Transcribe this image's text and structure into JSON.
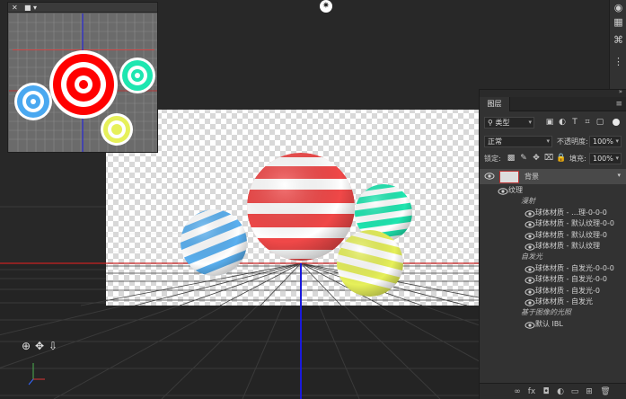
{
  "secondary_view": {
    "close_glyph": "✕",
    "camera_glyph": "■",
    "menu_glyph": "▾"
  },
  "light_glyph": "✷",
  "right_tools": [
    "◉",
    "▦",
    "⌘",
    "⋮"
  ],
  "layers_panel": {
    "collapse_glyph": "»",
    "tab_label": "图层",
    "menu_glyph": "≡",
    "filter": {
      "value": "类型",
      "icons": [
        "image-filter-icon",
        "adjust-filter-icon",
        "text-filter-icon",
        "shape-filter-icon",
        "smart-filter-icon"
      ]
    },
    "blend_mode": "正常",
    "opacity_label": "不透明度:",
    "opacity_value": "100%",
    "lock_label": "锁定:",
    "fill_label": "填充:",
    "fill_value": "100%",
    "layers": [
      {
        "label": "背景",
        "indent": 0,
        "type": "layer",
        "has_eye": true,
        "selected": true
      },
      {
        "label": "纹理",
        "indent": 1,
        "type": "group",
        "has_eye": true
      },
      {
        "label": "漫射",
        "indent": 2,
        "type": "section",
        "has_eye": false
      },
      {
        "label": "球体材质 - …理-0-0-0",
        "indent": 3,
        "type": "item",
        "has_eye": true
      },
      {
        "label": "球体材质 - 默认纹理-0-0",
        "indent": 3,
        "type": "item",
        "has_eye": true
      },
      {
        "label": "球体材质 - 默认纹理-0",
        "indent": 3,
        "type": "item",
        "has_eye": true
      },
      {
        "label": "球体材质 - 默认纹理",
        "indent": 3,
        "type": "item",
        "has_eye": true
      },
      {
        "label": "自发光",
        "indent": 2,
        "type": "section",
        "has_eye": false
      },
      {
        "label": "球体材质 - 自发光-0-0-0",
        "indent": 3,
        "type": "item",
        "has_eye": true
      },
      {
        "label": "球体材质 - 自发光-0-0",
        "indent": 3,
        "type": "item",
        "has_eye": true
      },
      {
        "label": "球体材质 - 自发光-0",
        "indent": 3,
        "type": "item",
        "has_eye": true
      },
      {
        "label": "球体材质 - 自发光",
        "indent": 3,
        "type": "item",
        "has_eye": true
      },
      {
        "label": "基于图像的光照",
        "indent": 2,
        "type": "section",
        "has_eye": false
      },
      {
        "label": "默认 IBL",
        "indent": 3,
        "type": "item",
        "has_eye": true
      }
    ],
    "bottom_icons": [
      "∞",
      "fx",
      "◘",
      "◐",
      "▭",
      "⊞",
      "🗑"
    ]
  },
  "nav_icons": [
    "⊕",
    "✥",
    "⇩"
  ],
  "colors": {
    "sphere_red": "#f04848",
    "sphere_blue": "#5ab0f0",
    "sphere_teal": "#1ee6b0",
    "sphere_yellow": "#e6f05a",
    "axis_blue": "#1a1adc",
    "axis_red": "#c82020"
  }
}
